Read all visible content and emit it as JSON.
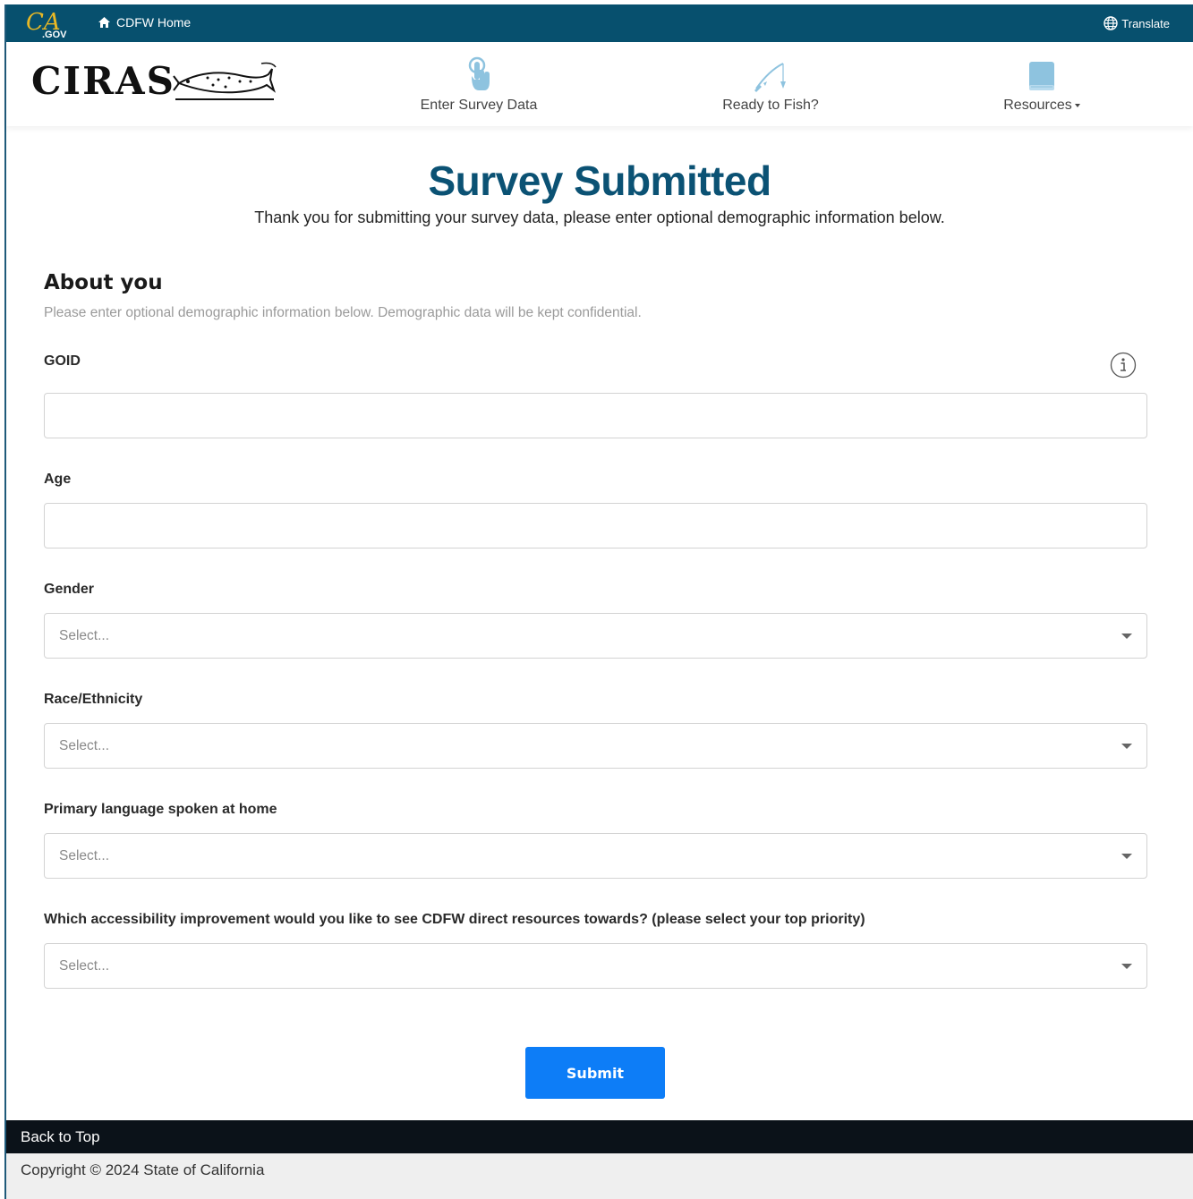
{
  "topbar": {
    "ca_logo": "CA.GOV",
    "home_label": "CDFW Home",
    "translate_label": "Translate"
  },
  "header": {
    "brand": "CIRAS",
    "nav": [
      {
        "label": "Enter Survey Data",
        "icon": "touch-hand-icon"
      },
      {
        "label": "Ready to Fish?",
        "icon": "fishing-rod-icon"
      },
      {
        "label": "Resources",
        "icon": "book-icon",
        "has_dropdown": true
      }
    ]
  },
  "main": {
    "title": "Survey Submitted",
    "subtitle": "Thank you for submitting your survey data, please enter optional demographic information below.",
    "about_heading": "About you",
    "about_text": "Please enter optional demographic information below. Demographic data will be kept confidential.",
    "fields": {
      "goid": {
        "label": "GOID",
        "value": ""
      },
      "age": {
        "label": "Age",
        "value": ""
      },
      "gender": {
        "label": "Gender",
        "selected": "Select..."
      },
      "race": {
        "label": "Race/Ethnicity",
        "selected": "Select..."
      },
      "language": {
        "label": "Primary language spoken at home",
        "selected": "Select..."
      },
      "accessibility": {
        "label": "Which accessibility improvement would you like to see CDFW direct resources towards? (please select your top priority)",
        "selected": "Select..."
      }
    },
    "submit_label": "Submit"
  },
  "footer": {
    "back_to_top": "Back to Top",
    "copyright": "Copyright © 2024 State of California"
  },
  "colors": {
    "topbar": "#07506e",
    "title": "#0b5274",
    "submit": "#0d7df7",
    "nav_icon": "#8ec3df",
    "footer_dark": "#0b1219"
  }
}
